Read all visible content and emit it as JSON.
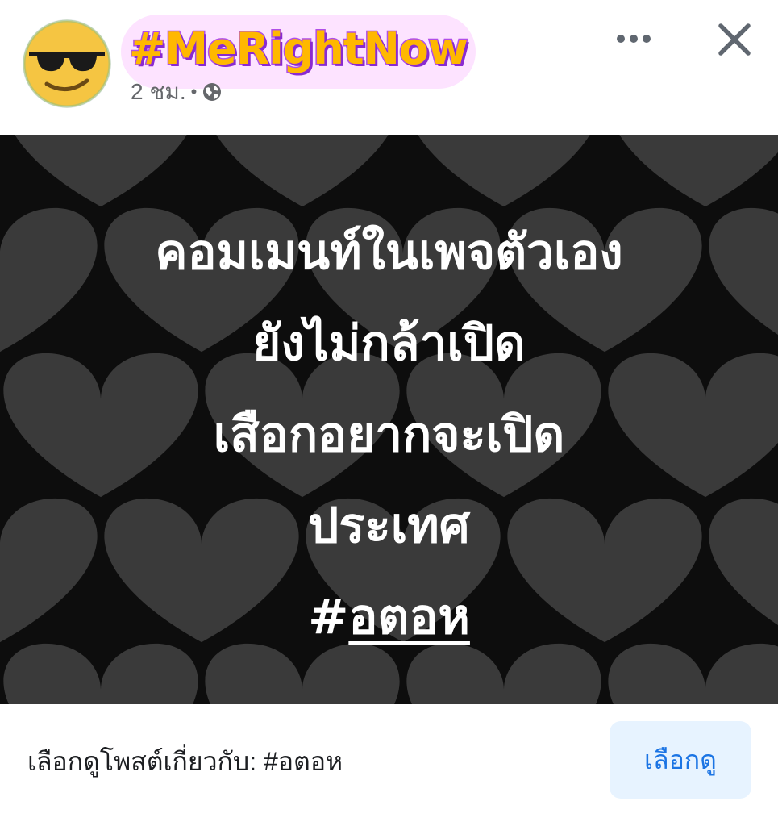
{
  "header": {
    "hashtag_title": "#MeRightNow",
    "time": "2 ชม.",
    "separator": "•"
  },
  "icons": {
    "avatar": "sunglasses-emoji-icon",
    "privacy": "globe-icon",
    "more": "more-dots-icon",
    "close": "close-icon"
  },
  "post": {
    "lines": [
      "คอมเมนท์ในเพจตัวเอง",
      "ยังไม่กล้าเปิด",
      "เสือกอยากจะเปิด",
      "ประเทศ"
    ],
    "hashtag_prefix": "#",
    "hashtag_link": "อตอห"
  },
  "footer": {
    "prompt": "เลือกดูโพสต์เกี่ยวกับ: #อตอห",
    "button_label": "เลือกดู"
  },
  "colors": {
    "accent": "#1b74e4",
    "button_bg": "#e7f3ff",
    "title_fill": "#ffb800",
    "title_stroke": "#b04ee8",
    "image_bg": "#0d0d0d",
    "heart": "#3a3a3a"
  }
}
